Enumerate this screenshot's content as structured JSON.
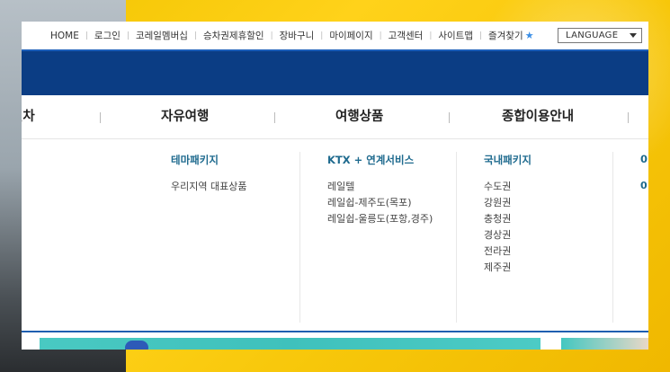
{
  "top_nav": {
    "items": [
      "HOME",
      "로그인",
      "코레일멤버십",
      "승차권제휴할인",
      "장바구니",
      "마이페이지",
      "고객센터",
      "사이트맵",
      "즐겨찾기"
    ],
    "favorite_icon": "star-icon",
    "language_label": "LANGUAGE"
  },
  "main_menu": {
    "items": [
      "열차",
      "자유여행",
      "여행상품",
      "종합이용안내"
    ]
  },
  "dropdown": {
    "columns": [
      {
        "title": "테마패키지",
        "links": [
          "우리지역 대표상품"
        ]
      },
      {
        "title": "KTX + 연계서비스",
        "links": [
          "레일텔",
          "레일쉽-제주도(목포)",
          "레일쉽-울릉도(포항,경주)"
        ]
      },
      {
        "title": "국내패키지",
        "links": [
          "수도권",
          "강원권",
          "충청권",
          "경상권",
          "전라권",
          "제주권"
        ]
      },
      {
        "title": "0",
        "links": [
          "0"
        ]
      }
    ]
  },
  "colors": {
    "brand_blue": "#0b3d84",
    "column_title": "#1e6a8e",
    "bottom_line": "#1f5fb0"
  }
}
